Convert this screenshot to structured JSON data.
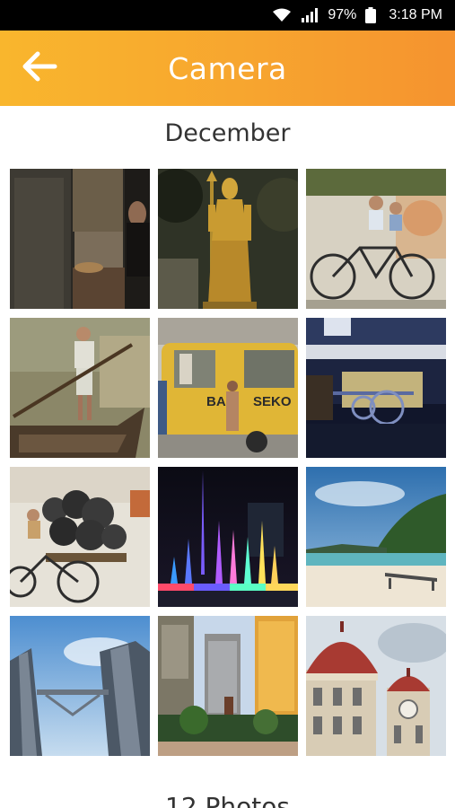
{
  "status_bar": {
    "battery": "97%",
    "time": "3:18 PM",
    "icons": [
      "wifi-icon",
      "signal-icon",
      "battery-icon"
    ]
  },
  "app_bar": {
    "title": "Camera",
    "back_icon": "arrow-left-icon",
    "colors": {
      "start": "#f9b62d",
      "end": "#f5932f",
      "title": "#ffffff"
    }
  },
  "gallery": {
    "section_title": "December",
    "photos": [
      {
        "name": "dark-bedroom-photo"
      },
      {
        "name": "golden-statue-photo"
      },
      {
        "name": "children-bicycle-mural-photo"
      },
      {
        "name": "boatman-mural-photo"
      },
      {
        "name": "yellow-school-bus-photo"
      },
      {
        "name": "night-building-photo"
      },
      {
        "name": "trishaw-mural-photo"
      },
      {
        "name": "fountain-lights-photo"
      },
      {
        "name": "beach-photo"
      },
      {
        "name": "twin-towers-photo"
      },
      {
        "name": "city-street-photo"
      },
      {
        "name": "domed-building-photo"
      }
    ],
    "photo_count_label": "12 Photos"
  }
}
